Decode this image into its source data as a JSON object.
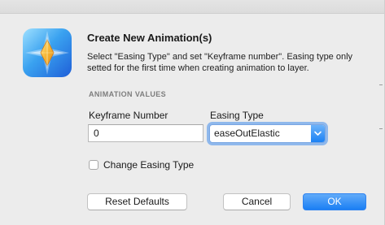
{
  "dialog": {
    "title": "Create New Animation(s)",
    "description": "Select \"Easing Type\" and set \"Keyframe number\". Easing type only setted for the first time when creating animation to layer.",
    "section_heading": "ANIMATION VALUES",
    "keyframe": {
      "label": "Keyframe Number",
      "value": "0"
    },
    "easing": {
      "label": "Easing Type",
      "selected": "easeOutElastic"
    },
    "change_easing": {
      "label": "Change Easing Type",
      "checked": false
    },
    "buttons": {
      "reset": "Reset Defaults",
      "cancel": "Cancel",
      "ok": "OK"
    }
  },
  "colors": {
    "background": "#ececec",
    "accent": "#1a7ff4",
    "focus_ring": "#8fb8ec",
    "icon_blue": "#2f8fe8",
    "icon_gold": "#f2b230"
  },
  "icons": {
    "app": "app-diamond-icon",
    "select_arrow": "chevron-down-icon"
  }
}
